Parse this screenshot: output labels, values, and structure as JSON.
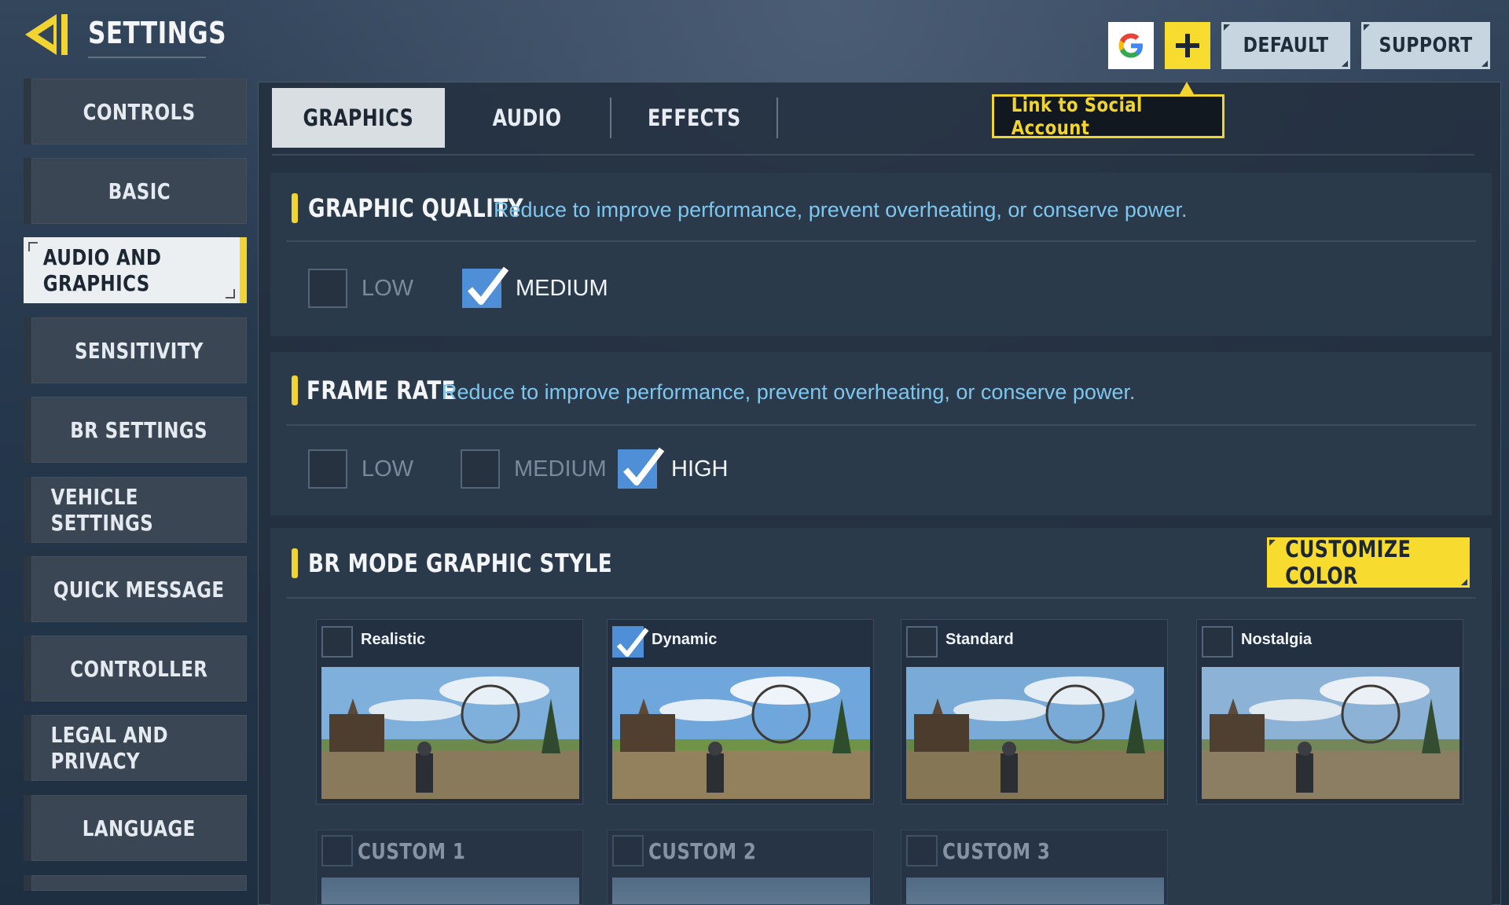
{
  "header": {
    "title": "SETTINGS",
    "default_label": "DEFAULT",
    "support_label": "SUPPORT",
    "tooltip": "Link to Social Account"
  },
  "sidebar": {
    "items": [
      {
        "label": "CONTROLS"
      },
      {
        "label": "BASIC"
      },
      {
        "label": "AUDIO AND GRAPHICS",
        "active": true
      },
      {
        "label": "SENSITIVITY"
      },
      {
        "label": "BR SETTINGS"
      },
      {
        "label": "VEHICLE SETTINGS"
      },
      {
        "label": "QUICK MESSAGE"
      },
      {
        "label": "CONTROLLER"
      },
      {
        "label": "LEGAL AND PRIVACY"
      },
      {
        "label": "LANGUAGE"
      }
    ]
  },
  "tabs": [
    {
      "label": "GRAPHICS",
      "active": true
    },
    {
      "label": "AUDIO"
    },
    {
      "label": "EFFECTS"
    }
  ],
  "graphic_quality": {
    "title": "GRAPHIC QUALITY",
    "description": "Reduce to improve performance, prevent overheating, or conserve power.",
    "options": [
      {
        "label": "LOW",
        "checked": false
      },
      {
        "label": "MEDIUM",
        "checked": true
      }
    ]
  },
  "frame_rate": {
    "title": "FRAME RATE",
    "description": "Reduce to improve performance, prevent overheating, or conserve power.",
    "options": [
      {
        "label": "LOW",
        "checked": false
      },
      {
        "label": "MEDIUM",
        "checked": false
      },
      {
        "label": "HIGH",
        "checked": true
      }
    ]
  },
  "br_style": {
    "title": "BR MODE GRAPHIC STYLE",
    "customize_label": "CUSTOMIZE COLOR",
    "styles": [
      {
        "label": "Realistic",
        "checked": false
      },
      {
        "label": "Dynamic",
        "checked": true
      },
      {
        "label": "Standard",
        "checked": false
      },
      {
        "label": "Nostalgia",
        "checked": false
      }
    ],
    "custom_slots": [
      {
        "label": "CUSTOM 1"
      },
      {
        "label": "CUSTOM 2"
      },
      {
        "label": "CUSTOM 3"
      }
    ]
  },
  "colors": {
    "accent": "#f2d430",
    "checkbox_on": "#4f8fd8",
    "description_text": "#7fc6ee"
  },
  "icons": {
    "back": "back-arrow-icon",
    "google": "google-icon",
    "plus": "plus-icon",
    "check": "checkmark-icon"
  }
}
